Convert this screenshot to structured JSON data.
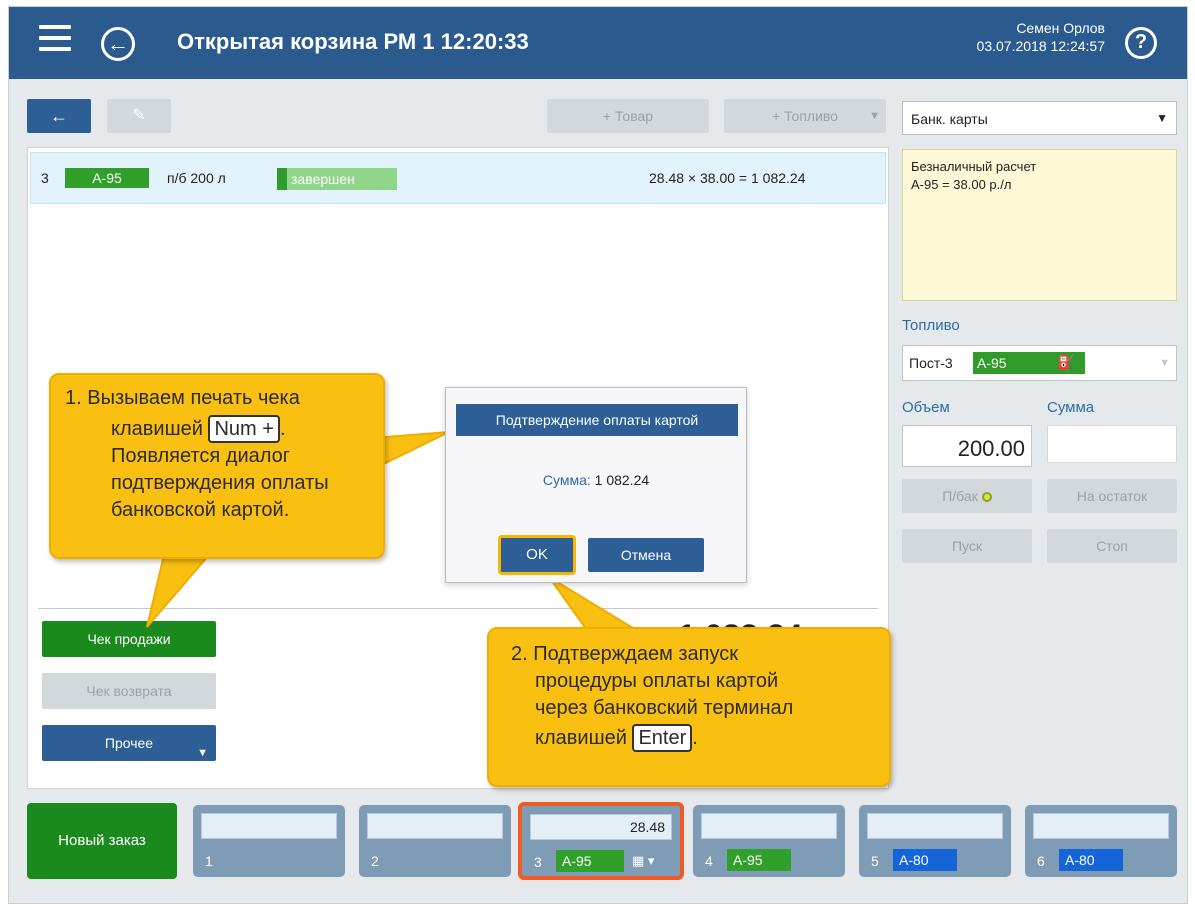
{
  "header": {
    "title": "Открытая корзина  РМ 1  12:20:33",
    "user_name": "Семен Орлов",
    "user_datetime": "03.07.2018 12:24:57",
    "back_icon": "←",
    "help_icon": "?"
  },
  "toolbar": {
    "back_label": "←",
    "edit_label": "✎",
    "add_item_label": "+ Товар",
    "add_fuel_label": "+ Топливо",
    "add_fuel_arrow": "▼"
  },
  "payment_select": {
    "value": "Банк. карты",
    "arrow": "▼"
  },
  "cart": {
    "items": [
      {
        "num": "3",
        "fuel": "А-95",
        "desc": "п/б 200 л",
        "status": "завершен",
        "calc": "28.48 × 38.00 = 1 082.24"
      }
    ],
    "total_partial": "1 082.24"
  },
  "info_box": {
    "line1": "Безналичный расчет",
    "line2": "А-95 = 38.00 р./л"
  },
  "fuel_panel": {
    "fuel_label": "Топливо",
    "pump_label": "Пост-3",
    "pump_fuel": "А-95",
    "nozzle_icon": "⛽",
    "pump_arrow": "▼",
    "volume_label": "Объем",
    "sum_label": "Сумма",
    "volume_value": "200.00",
    "full_tank_label": "П/бак",
    "remainder_label": "На остаток",
    "start_label": "Пуск",
    "stop_label": "Стоп"
  },
  "left_buttons": {
    "sale_receipt": "Чек продажи",
    "return_receipt": "Чек возврата",
    "other": "Прочее",
    "other_arrow": "▼"
  },
  "dialog": {
    "title": "Подтверждение оплаты картой",
    "sum_key": "Сумма:",
    "sum_value": "1 082.24",
    "ok_label": "OK",
    "cancel_label": "Отмена"
  },
  "callout1": {
    "line1": "1. Вызываем печать чека",
    "line2": "клавишей",
    "key": "Num +",
    "line2_end": ".",
    "line3": "Появляется диалог",
    "line4": "подтверждения оплаты",
    "line5": "банковской картой."
  },
  "callout2": {
    "line1": "2. Подтверждаем запуск",
    "line2": "процедуры оплаты картой",
    "line3": "через банковский терминал",
    "line4": "клавишей",
    "key": "Enter",
    "line4_end": "."
  },
  "bottom": {
    "new_order": "Новый заказ",
    "tabs": [
      {
        "num": "1",
        "value": "",
        "fuel": ""
      },
      {
        "num": "2",
        "value": "",
        "fuel": ""
      },
      {
        "num": "3",
        "value": "28.48",
        "fuel": "А-95",
        "icon": "▦ ▾"
      },
      {
        "num": "4",
        "value": "",
        "fuel": "А-95"
      },
      {
        "num": "5",
        "value": "",
        "fuel": "А-80"
      },
      {
        "num": "6",
        "value": "",
        "fuel": "А-80"
      }
    ]
  },
  "colors": {
    "header": "#2b5a8e",
    "accent_blue": "#2d5f96",
    "green": "#1a8a1e",
    "fuel_a95": "#31a02a",
    "fuel_a80": "#1565d8",
    "callout": "#f9bf11",
    "active_tab_border": "#f15a24"
  }
}
